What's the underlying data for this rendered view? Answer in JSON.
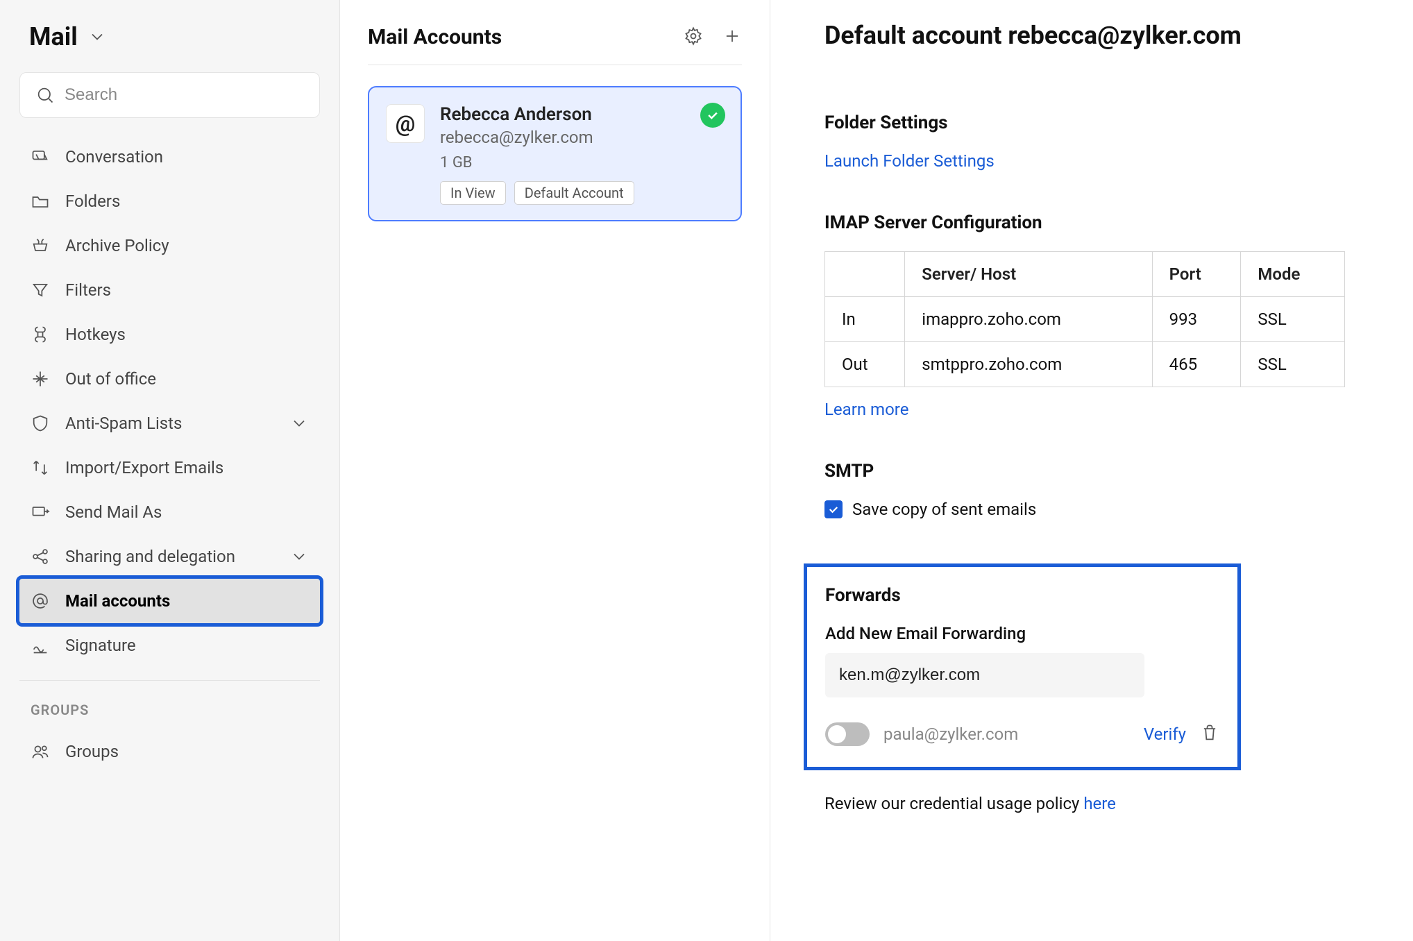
{
  "app": {
    "title": "Mail"
  },
  "search": {
    "placeholder": "Search"
  },
  "sidebar": {
    "items": [
      {
        "label": "Conversation"
      },
      {
        "label": "Folders"
      },
      {
        "label": "Archive Policy"
      },
      {
        "label": "Filters"
      },
      {
        "label": "Hotkeys"
      },
      {
        "label": "Out of office"
      },
      {
        "label": "Anti-Spam Lists"
      },
      {
        "label": "Import/Export Emails"
      },
      {
        "label": "Send Mail As"
      },
      {
        "label": "Sharing and delegation"
      },
      {
        "label": "Mail accounts"
      },
      {
        "label": "Signature"
      }
    ],
    "groups_label": "GROUPS",
    "groups_item": "Groups"
  },
  "middle": {
    "title": "Mail Accounts",
    "account": {
      "name": "Rebecca Anderson",
      "email": "rebecca@zylker.com",
      "quota": "1 GB",
      "tags": [
        "In View",
        "Default Account"
      ]
    }
  },
  "detail": {
    "title": "Default account rebecca@zylker.com",
    "folder_heading": "Folder Settings",
    "folder_link": "Launch Folder Settings",
    "imap_heading": "IMAP Server Configuration",
    "imap_table": {
      "headers": [
        "",
        "Server/ Host",
        "Port",
        "Mode"
      ],
      "rows": [
        [
          "In",
          "imappro.zoho.com",
          "993",
          "SSL"
        ],
        [
          "Out",
          "smtppro.zoho.com",
          "465",
          "SSL"
        ]
      ]
    },
    "learn_more": "Learn more",
    "smtp_heading": "SMTP",
    "smtp_checkbox": "Save copy of sent emails",
    "forwards": {
      "heading": "Forwards",
      "sub_heading": "Add New Email Forwarding",
      "input_value": "ken.m@zylker.com",
      "pending_email": "paula@zylker.com",
      "verify_label": "Verify"
    },
    "policy_text": "Review our credential usage policy ",
    "policy_link": "here"
  }
}
